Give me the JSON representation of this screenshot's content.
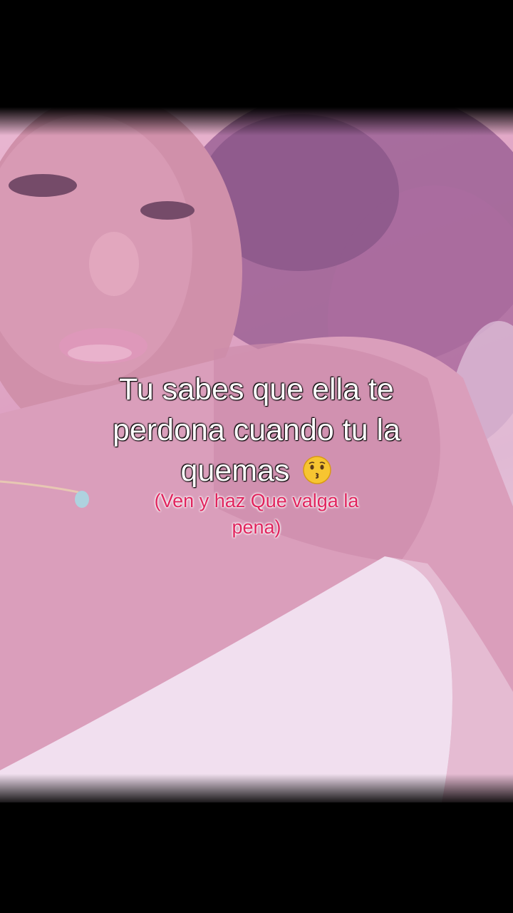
{
  "caption": {
    "line1": "Tu sabes que ella te",
    "line2": "perdona cuando tu la",
    "line3": "quemas",
    "emoji": "kissing-face-icon"
  },
  "subcaption": {
    "line1": "(Ven y haz Que valga la",
    "line2": "pena)"
  },
  "colors": {
    "caption_text": "#ffffff",
    "subcaption_text": "#e0245e",
    "letterbox": "#000000",
    "photo_tint": "#d99cbd"
  }
}
